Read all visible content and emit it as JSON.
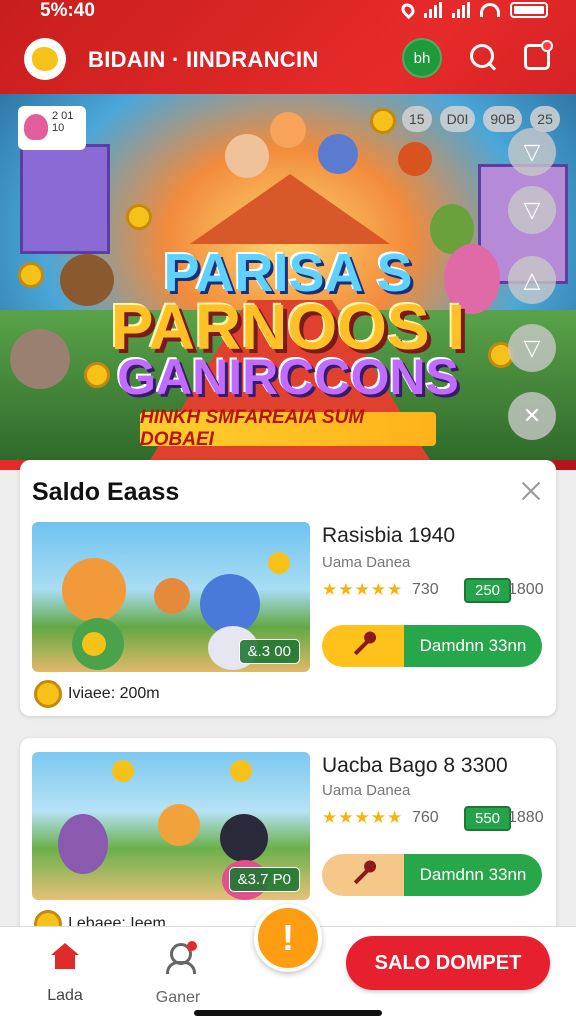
{
  "status_bar": {
    "time": "5%:40"
  },
  "header": {
    "brand": "BIDAIN · IINDRANCIN",
    "avatar_initials": "bh"
  },
  "banner": {
    "title_line1": "PARISA S",
    "title_line2": "PARNOOS I",
    "title_line3": "GANIRCCONS",
    "subtitle": "HINKH SMFAREAIA SUM DOBAEI",
    "tile_text": "2 01 10",
    "chips": [
      "15",
      "D0I",
      "90B",
      "25"
    ],
    "controls": [
      "▽",
      "▽",
      "△",
      "▽",
      "✕"
    ]
  },
  "section": {
    "title": "Saldo Eaass"
  },
  "cards": [
    {
      "title": "Rasisbia 1940",
      "subtitle": "Uama Danea",
      "stars": "★★★★★",
      "rating": "730",
      "price": "250",
      "old_price": "1800",
      "button_label": "Damdnn 33nn",
      "thumb_badge": "&.3 00",
      "footer": "Iviaee: 200m"
    },
    {
      "title": "Uacba Bago 8 3300",
      "subtitle": "Uama Danea",
      "stars": "★★★★★",
      "rating": "760",
      "price": "550",
      "old_price": "1880",
      "button_label": "Damdnn 33nn",
      "thumb_badge": "&3.7 P0",
      "footer": "I ebaee: Ieem"
    }
  ],
  "bottom_nav": {
    "home_label": "Lada",
    "games_label": "Ganer",
    "fab_label": "!",
    "wallet_label": "SALO DOMPET"
  },
  "colors": {
    "brand_red": "#e6202f",
    "accent_green": "#28a64a",
    "accent_yellow": "#ffc21a",
    "fab_orange": "#ff9d12"
  }
}
